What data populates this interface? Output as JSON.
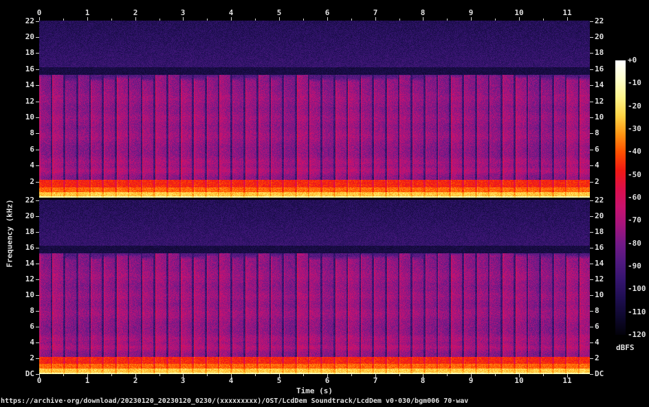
{
  "page": {
    "url_line": "https://archive·org/download/20230120_20230120_0230/(xxxxxxxxx)/OST/LcdDem Soundtrack/LcdDem v0·030/bgm006 70·wav",
    "background_color": "#000000",
    "text_color": "#e0e0e0"
  },
  "chart_data": {
    "type": "heatmap",
    "subtype": "audio-spectrogram",
    "channels": 2,
    "xlabel": "Time (s)",
    "ylabel": "Frequency (kHz)",
    "colorbar_label": "dBFS",
    "x_range_s": [
      0,
      11.48
    ],
    "x_ticks": [
      "0",
      "1",
      "2",
      "3",
      "4",
      "5",
      "6",
      "7",
      "8",
      "9",
      "10",
      "11"
    ],
    "x_minor_tick_step_s": 0.5,
    "y_range_khz": [
      0,
      22.05
    ],
    "y_ticks_ch1": [
      "22",
      "20",
      "18",
      "16",
      "14",
      "12",
      "10",
      "8",
      "6",
      "4",
      "2"
    ],
    "y_ticks_ch2": [
      "22",
      "20",
      "18",
      "16",
      "14",
      "12",
      "10",
      "8",
      "6",
      "4",
      "2",
      "DC"
    ],
    "colorbar_ticks": [
      "+0",
      "-10",
      "-20",
      "-30",
      "-40",
      "-50",
      "-60",
      "-70",
      "-80",
      "-90",
      "-100",
      "-110",
      "-120"
    ],
    "colorbar_range_db": [
      0,
      -120
    ],
    "palette_stops_db_rgb": [
      [
        0,
        [
          255,
          255,
          255
        ]
      ],
      [
        -8,
        [
          255,
          255,
          205
        ]
      ],
      [
        -16,
        [
          255,
          244,
          140
        ]
      ],
      [
        -24,
        [
          255,
          212,
          70
        ]
      ],
      [
        -32,
        [
          255,
          150,
          20
        ]
      ],
      [
        -40,
        [
          255,
          80,
          0
        ]
      ],
      [
        -48,
        [
          240,
          25,
          20
        ]
      ],
      [
        -56,
        [
          220,
          15,
          75
        ]
      ],
      [
        -64,
        [
          200,
          18,
          110
        ]
      ],
      [
        -72,
        [
          165,
          20,
          125
        ]
      ],
      [
        -80,
        [
          115,
          25,
          135
        ]
      ],
      [
        -88,
        [
          80,
          25,
          128
        ]
      ],
      [
        -96,
        [
          52,
          20,
          110
        ]
      ],
      [
        -104,
        [
          30,
          14,
          80
        ]
      ],
      [
        -112,
        [
          14,
          8,
          45
        ]
      ],
      [
        -120,
        [
          2,
          1,
          8
        ]
      ]
    ],
    "features": {
      "beat_interval_s": 0.268,
      "beat_column_top_khz": 14.8,
      "lowpass_cutoff_khz": 15.3,
      "upper_noise_band_khz": [
        16.3,
        22.05
      ],
      "upper_noise_level_db": -97,
      "background_level_db": -88,
      "beat_column_level_db": -74,
      "beat_attack_level_db": -64,
      "red_band_khz": [
        1.35,
        2.25
      ],
      "red_band_level_db": -50,
      "orange_band_khz": [
        0.7,
        1.35
      ],
      "orange_band_level_db": -40,
      "bass_band_khz": [
        0.12,
        0.7
      ],
      "bass_band_level_db": -27,
      "dc_line_level_db": -16,
      "resonance_bands_khz": [
        3.4,
        4.5,
        7.7,
        9.9,
        12.4
      ]
    }
  }
}
